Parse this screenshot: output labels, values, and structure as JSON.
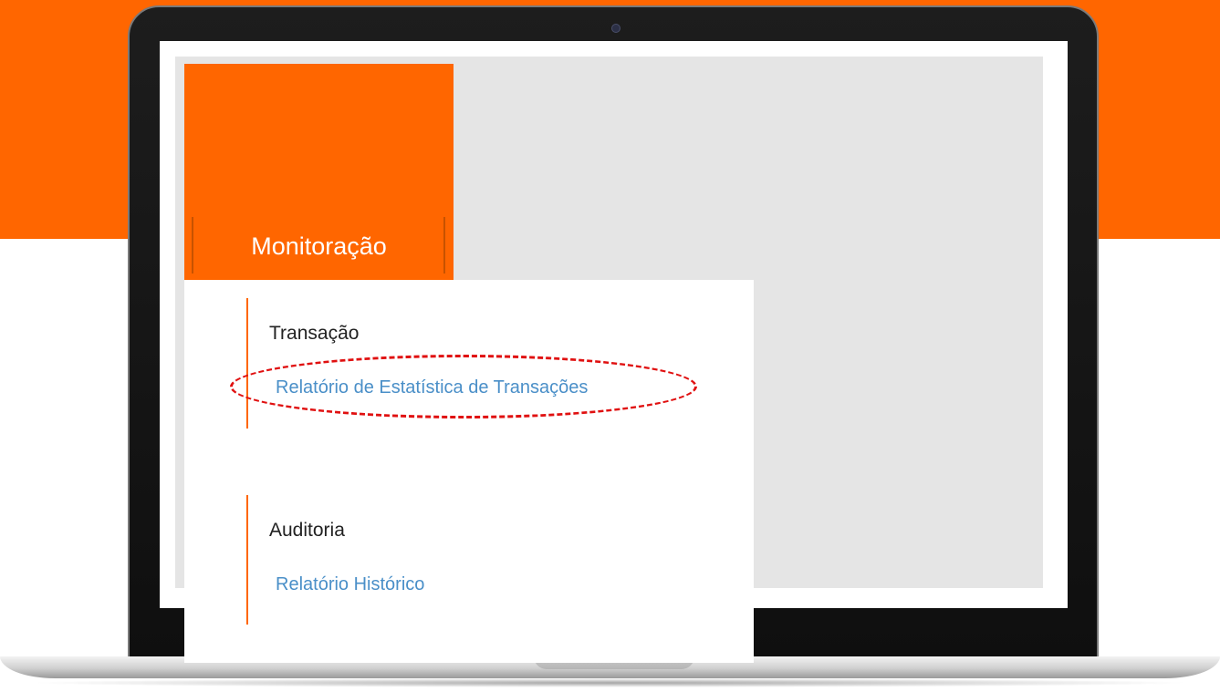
{
  "menu": {
    "tile_label": "Monitoração",
    "sections": [
      {
        "title": "Transação",
        "links": [
          "Relatório de Estatística de Transações"
        ]
      },
      {
        "title": "Auditoria",
        "links": [
          "Relatório Histórico"
        ]
      }
    ]
  },
  "colors": {
    "brand_orange": "#ff6600",
    "link_blue": "#4a8fc8",
    "highlight_red": "#e01010"
  }
}
